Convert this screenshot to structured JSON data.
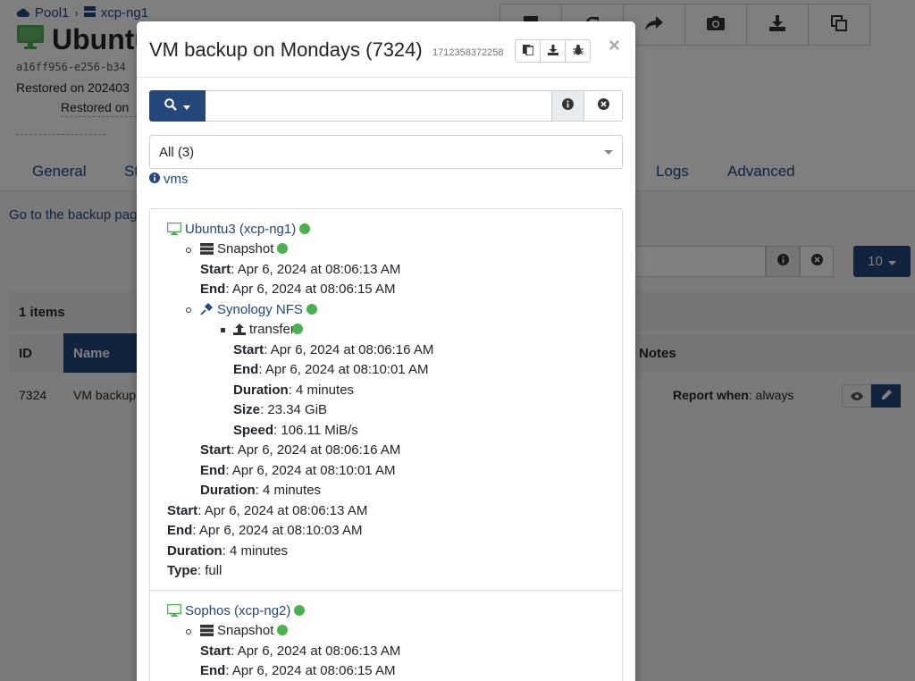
{
  "background": {
    "breadcrumb": {
      "pool": "Pool1",
      "host": "xcp-ng1"
    },
    "vm_name": "Ubuntu",
    "uuid": "a16ff956-e256-b34",
    "restored_1": "Restored on 202403",
    "restored_2": "Restored on",
    "tabs": {
      "general": "General",
      "st": "St",
      "logs": "Logs",
      "advanced": "Advanced"
    },
    "backup_link": "Go to the backup pag",
    "pager_value": "10",
    "items_count": "1 items",
    "columns": {
      "id": "ID",
      "name": "Name",
      "notes": "Notes"
    },
    "row": {
      "id": "7324",
      "name": "VM backup",
      "report_label": "Report when",
      "report_value": ": always"
    }
  },
  "modal": {
    "title": "VM backup on Mondays (7324)",
    "timestamp": "1712358372258",
    "filter_selected": "All (3)",
    "vms_link": "vms",
    "close": "×",
    "labels": {
      "start": "Start",
      "end": "End",
      "duration": "Duration",
      "size": "Size",
      "speed": "Speed",
      "type": "Type"
    },
    "vm1": {
      "name": "Ubuntu3 (xcp-ng1)",
      "snapshot": {
        "label": "Snapshot",
        "start": ": Apr 6, 2024 at 08:06:13 AM",
        "end": ": Apr 6, 2024 at 08:06:15 AM"
      },
      "remote": {
        "name": "Synology NFS",
        "transfer": {
          "label": "transfer",
          "start": ": Apr 6, 2024 at 08:06:16 AM",
          "end": ": Apr 6, 2024 at 08:10:01 AM",
          "duration": ": 4 minutes",
          "size": ": 23.34 GiB",
          "speed": ": 106.11 MiB/s"
        },
        "start": ": Apr 6, 2024 at 08:06:16 AM",
        "end": ": Apr 6, 2024 at 08:10:01 AM",
        "duration": ": 4 minutes"
      },
      "start": ": Apr 6, 2024 at 08:06:13 AM",
      "end": ": Apr 6, 2024 at 08:10:03 AM",
      "duration": ": 4 minutes",
      "type": ": full"
    },
    "vm2": {
      "name": "Sophos (xcp-ng2)",
      "snapshot": {
        "label": "Snapshot",
        "start": ": Apr 6, 2024 at 08:06:13 AM",
        "end": ": Apr 6, 2024 at 08:06:15 AM"
      }
    }
  },
  "colors": {
    "primary": "#24487a",
    "success": "#4caf50",
    "vm_icon": "#4caf50"
  }
}
